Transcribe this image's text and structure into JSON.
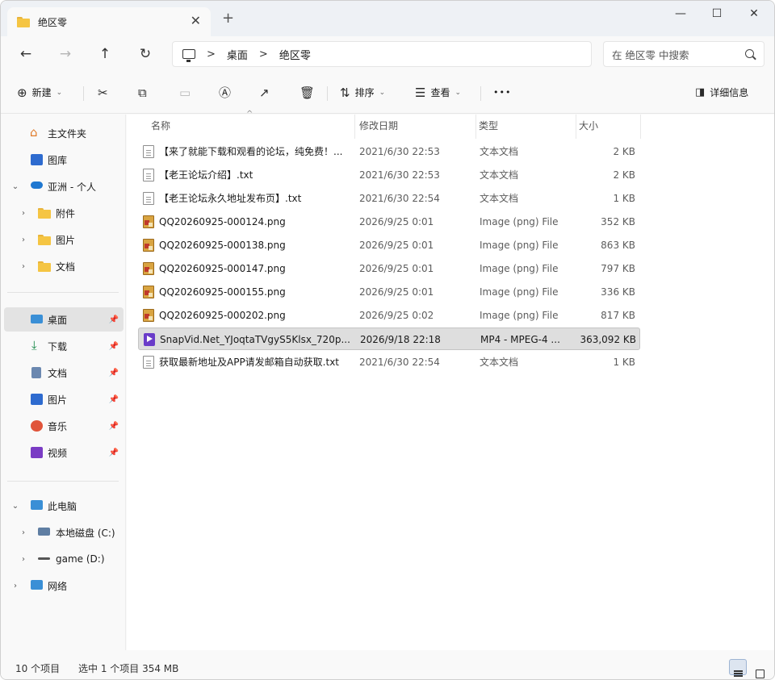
{
  "tab": {
    "title": "绝区零",
    "close": "✕",
    "new": "+"
  },
  "window_controls": {
    "minimize": "—",
    "maximize": "☐",
    "close": "✕"
  },
  "nav": {
    "back": "←",
    "forward": "→",
    "up": "↑",
    "refresh": "↻"
  },
  "breadcrumb": {
    "sep": ">",
    "items": [
      "桌面",
      "绝区零"
    ]
  },
  "search": {
    "placeholder": "在 绝区零 中搜索"
  },
  "toolbar": {
    "new_label": "新建",
    "sort_label": "排序",
    "view_label": "查看",
    "more": "•••",
    "details_label": "详细信息",
    "chevron": "⌄"
  },
  "sidebar": {
    "home": "主文件夹",
    "gallery": "图库",
    "onedrive": "亚洲 - 个人",
    "od_children": [
      "附件",
      "图片",
      "文档"
    ],
    "quick": [
      {
        "label": "桌面",
        "icon": "desktop-icon"
      },
      {
        "label": "下载",
        "icon": "download-icon"
      },
      {
        "label": "文档",
        "icon": "documents-icon"
      },
      {
        "label": "图片",
        "icon": "pictures-icon"
      },
      {
        "label": "音乐",
        "icon": "music-icon"
      },
      {
        "label": "视频",
        "icon": "videos-icon"
      }
    ],
    "this_pc": "此电脑",
    "drives": [
      "本地磁盘 (C:)",
      "game (D:)"
    ],
    "network": "网络"
  },
  "columns": {
    "name": "名称",
    "date": "修改日期",
    "type": "类型",
    "size": "大小"
  },
  "files": [
    {
      "name": "【来了就能下载和观看的论坛，纯免费！...",
      "date": "2021/6/30 22:53",
      "type": "文本文档",
      "size": "2 KB",
      "icon": "txt"
    },
    {
      "name": "【老王论坛介绍】.txt",
      "date": "2021/6/30 22:53",
      "type": "文本文档",
      "size": "2 KB",
      "icon": "txt"
    },
    {
      "name": "【老王论坛永久地址发布页】.txt",
      "date": "2021/6/30 22:54",
      "type": "文本文档",
      "size": "1 KB",
      "icon": "txt"
    },
    {
      "name": "QQ20260925-000124.png",
      "date": "2026/9/25 0:01",
      "type": "Image (png) File",
      "size": "352 KB",
      "icon": "png"
    },
    {
      "name": "QQ20260925-000138.png",
      "date": "2026/9/25 0:01",
      "type": "Image (png) File",
      "size": "863 KB",
      "icon": "png"
    },
    {
      "name": "QQ20260925-000147.png",
      "date": "2026/9/25 0:01",
      "type": "Image (png) File",
      "size": "797 KB",
      "icon": "png"
    },
    {
      "name": "QQ20260925-000155.png",
      "date": "2026/9/25 0:01",
      "type": "Image (png) File",
      "size": "336 KB",
      "icon": "png"
    },
    {
      "name": "QQ20260925-000202.png",
      "date": "2026/9/25 0:02",
      "type": "Image (png) File",
      "size": "817 KB",
      "icon": "png"
    },
    {
      "name": "SnapVid.Net_YJoqtaTVgyS5Klsx_720p...",
      "date": "2026/9/18 22:18",
      "type": "MP4 - MPEG-4 ...",
      "size": "363,092 KB",
      "icon": "mp4",
      "selected": true
    },
    {
      "name": "获取最新地址及APP请发邮箱自动获取.txt",
      "date": "2021/6/30 22:54",
      "type": "文本文档",
      "size": "1 KB",
      "icon": "txt"
    }
  ],
  "status": {
    "count": "10 个项目",
    "selection": "选中 1 个项目  354 MB"
  }
}
